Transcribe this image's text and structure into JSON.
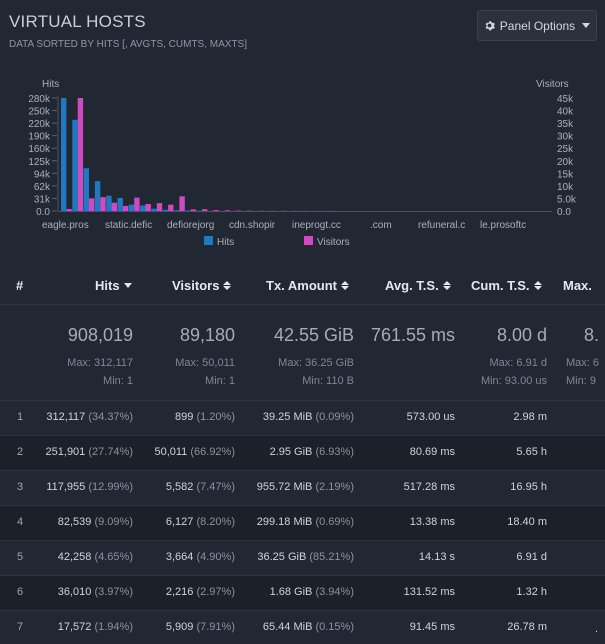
{
  "panel": {
    "title": "VIRTUAL HOSTS",
    "subtitle": "DATA SORTED BY HITS [, AVGTS, CUMTS, MAXTS]",
    "options_label": "Panel Options"
  },
  "chart_data": {
    "type": "bar",
    "left_axis_label": "Hits",
    "right_axis_label": "Visitors",
    "left_ticks": [
      "280k",
      "250k",
      "220k",
      "190k",
      "160k",
      "125k",
      "94k",
      "62k",
      "31k",
      "0.0"
    ],
    "right_ticks": [
      "45k",
      "40k",
      "35k",
      "30k",
      "25k",
      "20k",
      "15k",
      "10k",
      "5.0k",
      "0.0"
    ],
    "ylim_left": [
      0,
      312117
    ],
    "ylim_right": [
      0,
      50011
    ],
    "category_labels": [
      "eagle.pros",
      "static.defic",
      "defiorejorg",
      "cdn.shopir",
      "ineprogt.cc",
      ".com",
      "refuneral.c",
      "le.prosoftc"
    ],
    "series": [
      {
        "name": "Hits",
        "color": "#1f78c1",
        "values": [
          312117,
          251901,
          117955,
          82539,
          42258,
          36010,
          17572,
          15200,
          6500,
          3200,
          2100,
          1400,
          900,
          500,
          300,
          200,
          150,
          100,
          80,
          60,
          40,
          30,
          20,
          15
        ]
      },
      {
        "name": "Visitors",
        "color": "#cc4cbf",
        "values": [
          899,
          50011,
          5582,
          6127,
          3664,
          2216,
          5909,
          3100,
          3500,
          2800,
          6500,
          700,
          800,
          400,
          300,
          200,
          150,
          100,
          90,
          80,
          70,
          60,
          50,
          40
        ]
      }
    ],
    "legend": [
      {
        "label": "Hits",
        "color": "#1f78c1"
      },
      {
        "label": "Visitors",
        "color": "#cc4cbf"
      }
    ]
  },
  "table": {
    "headers": {
      "index": "#",
      "hits": "Hits",
      "visitors": "Visitors",
      "tx": "Tx. Amount",
      "avg": "Avg. T.S.",
      "cum": "Cum. T.S.",
      "max": "Max."
    },
    "summary": {
      "hits": {
        "total": "908,019",
        "max": "Max: 312,117",
        "min": "Min: 1"
      },
      "visitors": {
        "total": "89,180",
        "max": "Max: 50,011",
        "min": "Min: 1"
      },
      "tx": {
        "total": "42.55 GiB",
        "max": "Max: 36.25 GiB",
        "min": "Min: 110 B"
      },
      "avg": {
        "total": "761.55 ms"
      },
      "cum": {
        "total": "8.00 d",
        "max": "Max: 6.91 d",
        "min": "Min: 93.00 us"
      },
      "max": {
        "total": "8.",
        "max": "Max: 6",
        "min": "Min: 9"
      }
    },
    "rows": [
      {
        "idx": "1",
        "hits": "312,117",
        "hits_pct": "(34.37%)",
        "visitors": "899",
        "visitors_pct": "(1.20%)",
        "tx": "39.25 MiB",
        "tx_pct": "(0.09%)",
        "avg": "573.00 us",
        "cum": "2.98 m",
        "max": ""
      },
      {
        "idx": "2",
        "hits": "251,901",
        "hits_pct": "(27.74%)",
        "visitors": "50,011",
        "visitors_pct": "(66.92%)",
        "tx": "2.95 GiB",
        "tx_pct": "(6.93%)",
        "avg": "80.69 ms",
        "cum": "5.65 h",
        "max": ""
      },
      {
        "idx": "3",
        "hits": "117,955",
        "hits_pct": "(12.99%)",
        "visitors": "5,582",
        "visitors_pct": "(7.47%)",
        "tx": "955.72 MiB",
        "tx_pct": "(2.19%)",
        "avg": "517.28 ms",
        "cum": "16.95 h",
        "max": ""
      },
      {
        "idx": "4",
        "hits": "82,539",
        "hits_pct": "(9.09%)",
        "visitors": "6,127",
        "visitors_pct": "(8.20%)",
        "tx": "299.18 MiB",
        "tx_pct": "(0.69%)",
        "avg": "13.38 ms",
        "cum": "18.40 m",
        "max": ""
      },
      {
        "idx": "5",
        "hits": "42,258",
        "hits_pct": "(4.65%)",
        "visitors": "3,664",
        "visitors_pct": "(4.90%)",
        "tx": "36.25 GiB",
        "tx_pct": "(85.21%)",
        "avg": "14.13 s",
        "cum": "6.91 d",
        "max": ""
      },
      {
        "idx": "6",
        "hits": "36,010",
        "hits_pct": "(3.97%)",
        "visitors": "2,216",
        "visitors_pct": "(2.97%)",
        "tx": "1.68 GiB",
        "tx_pct": "(3.94%)",
        "avg": "131.52 ms",
        "cum": "1.32 h",
        "max": ""
      },
      {
        "idx": "7",
        "hits": "17,572",
        "hits_pct": "(1.94%)",
        "visitors": "5,909",
        "visitors_pct": "(7.91%)",
        "tx": "65.44 MiB",
        "tx_pct": "(0.15%)",
        "avg": "91.45 ms",
        "cum": "26.78 m",
        "max": "."
      }
    ]
  }
}
